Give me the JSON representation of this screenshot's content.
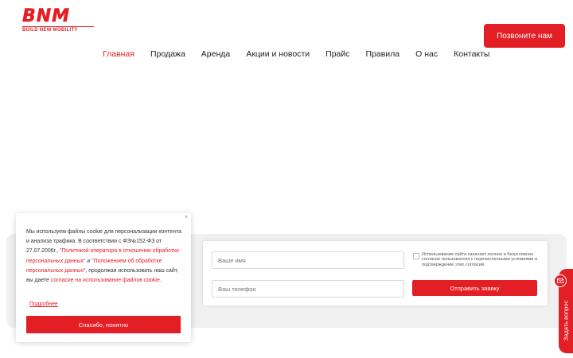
{
  "header": {
    "logo_text": "BNM",
    "logo_tagline": "BUILD NEW MOBILITY",
    "call_button": "Позвоните нам"
  },
  "nav": {
    "items": [
      {
        "label": "Главная",
        "active": true
      },
      {
        "label": "Продажа",
        "active": false
      },
      {
        "label": "Аренда",
        "active": false
      },
      {
        "label": "Акции и новости",
        "active": false
      },
      {
        "label": "Прайс",
        "active": false
      },
      {
        "label": "Правила",
        "active": false
      },
      {
        "label": "О нас",
        "active": false
      },
      {
        "label": "Контакты",
        "active": false
      }
    ]
  },
  "form": {
    "name_placeholder": "Ваше имя",
    "phone_placeholder": "Ваш телефон",
    "consent_text": "Использование сайта означает полное и безусловное согласие пользователя с перечисленными условиями и подтверждение этих согласий.",
    "submit_label": "Отправить заявку"
  },
  "cookie": {
    "close_glyph": "×",
    "text_1": "Мы используем файлы cookie для персонализации контента и анализа трафика. В соответствии с ФЗ№152-ФЗ от 27.07.2006г., ",
    "link_1": "\"Политикой оператора в отношении обработки персональных данных\"",
    "text_2": " и ",
    "link_2": "\"Положением об обработке персональных данных\"",
    "text_3": ", продолжая использовать наш сайт, вы даете ",
    "link_3": "согласие на использование файлов cookie",
    "text_4": ".",
    "more_link": "Подробнее",
    "accept_button": "Спасибо, понятно"
  },
  "side_tab": {
    "label": "Задать вопрос",
    "icon": "mail-icon"
  },
  "colors": {
    "accent": "#e31e24",
    "band": "#f0f0f0"
  }
}
